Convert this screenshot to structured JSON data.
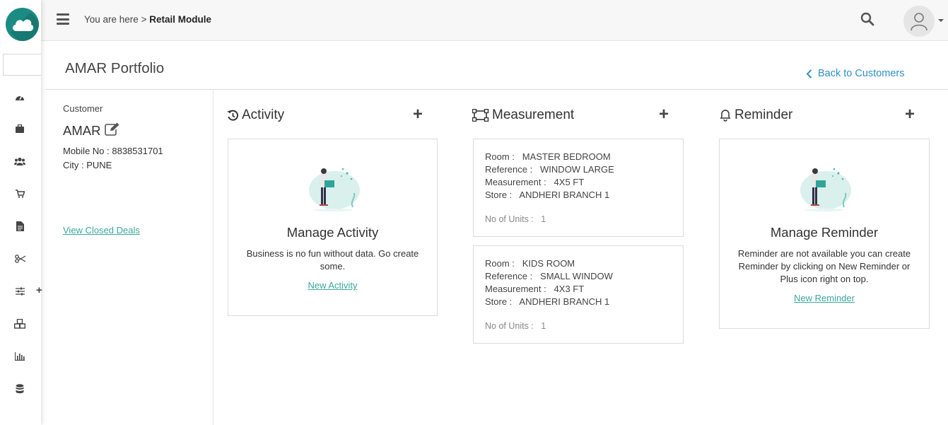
{
  "topbar": {
    "breadcrumb_prefix": "You are here >",
    "breadcrumb_current": "Retail Module"
  },
  "sidebar": {
    "items": [
      {
        "icon": "dashboard-icon"
      },
      {
        "icon": "briefcase-icon"
      },
      {
        "icon": "users-icon"
      },
      {
        "icon": "cart-icon"
      },
      {
        "icon": "document-icon"
      },
      {
        "icon": "scissors-icon"
      },
      {
        "icon": "sliders-icon"
      },
      {
        "icon": "cubes-icon"
      },
      {
        "icon": "bar-chart-icon"
      },
      {
        "icon": "database-icon"
      }
    ]
  },
  "page": {
    "title": "AMAR Portfolio",
    "back_link": "Back to Customers"
  },
  "customer": {
    "label": "Customer",
    "name": "AMAR",
    "mobile": "Mobile No : 8838531701",
    "city": "City : PUNE",
    "closed_deals_link": "View Closed Deals"
  },
  "activity": {
    "heading": "Activity",
    "add": "+",
    "empty_title": "Manage Activity",
    "empty_desc": "Business is no fun without data. Go create some.",
    "link": "New Activity"
  },
  "measurement": {
    "heading": "Measurement",
    "add": "+",
    "items": [
      {
        "room": "Room :   MASTER BEDROOM",
        "reference": "Reference :   WINDOW LARGE",
        "measurement": "Measurement :   4X5 FT",
        "store": "Store :   ANDHERI BRANCH 1",
        "units": "No of Units :   1"
      },
      {
        "room": "Room :   KIDS ROOM",
        "reference": "Reference :   SMALL WINDOW",
        "measurement": "Measurement :   4X3 FT",
        "store": "Store :   ANDHERI BRANCH 1",
        "units": "No of Units :   1"
      }
    ]
  },
  "reminder": {
    "heading": "Reminder",
    "add": "+",
    "empty_title": "Manage Reminder",
    "empty_desc": "Reminder are not available you can create Reminder by clicking on New Reminder or Plus icon right on top.",
    "link": "New Reminder"
  },
  "colors": {
    "brand": "#1a8c84",
    "link_teal": "#3aa89c",
    "link_blue": "#2f8fc7"
  }
}
